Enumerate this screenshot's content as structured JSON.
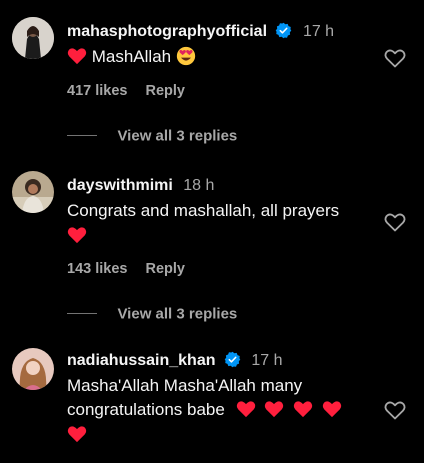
{
  "comments": [
    {
      "username": "mahasphotographyofficial",
      "verified": true,
      "time": "17 h",
      "text": "MashAllah",
      "likes": "417 likes",
      "reply_label": "Reply",
      "view_replies": "View all 3 replies",
      "emojis_before": [
        "red-heart"
      ],
      "emojis_after": [
        "heart-eyes"
      ]
    },
    {
      "username": "dayswithmimi",
      "verified": false,
      "time": "18 h",
      "text": "Congrats and mashallah, all prayers",
      "likes": "143 likes",
      "reply_label": "Reply",
      "view_replies": "View all 3 replies",
      "emojis_after": [
        "red-heart"
      ]
    },
    {
      "username": "nadiahussain_khan",
      "verified": true,
      "time": "17 h",
      "text_line1": "Masha'Allah Masha'Allah many",
      "text_line2": "congratulations babe",
      "emojis_after": [
        "red-heart",
        "red-heart",
        "red-heart",
        "red-heart",
        "red-heart"
      ]
    }
  ],
  "colors": {
    "background": "#000000",
    "text": "#f5f5f5",
    "secondary": "#a8a8a8",
    "verified": "#0095f6",
    "heart": "#ff1f3d"
  }
}
